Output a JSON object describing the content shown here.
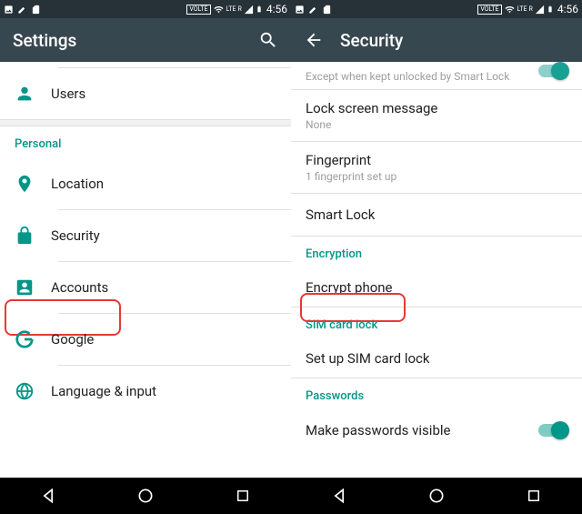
{
  "status": {
    "time": "4:56",
    "volte": "VOLTE",
    "lte": "LTE",
    "r": "R"
  },
  "left": {
    "title": "Settings",
    "items": {
      "users": "Users",
      "personal": "Personal",
      "location": "Location",
      "security": "Security",
      "accounts": "Accounts",
      "google": "Google",
      "lang": "Language & input"
    }
  },
  "right": {
    "title": "Security",
    "partial_note": "Except when kept unlocked by Smart Lock",
    "items": {
      "lockmsg": "Lock screen message",
      "lockmsg_sub": "None",
      "fingerprint": "Fingerprint",
      "fingerprint_sub": "1 fingerprint set up",
      "smartlock": "Smart Lock",
      "enc_header": "Encryption",
      "encrypt": "Encrypt phone",
      "sim_header": "SIM card lock",
      "sim": "Set up SIM card lock",
      "pw_header": "Passwords",
      "pw": "Make passwords visible"
    }
  }
}
